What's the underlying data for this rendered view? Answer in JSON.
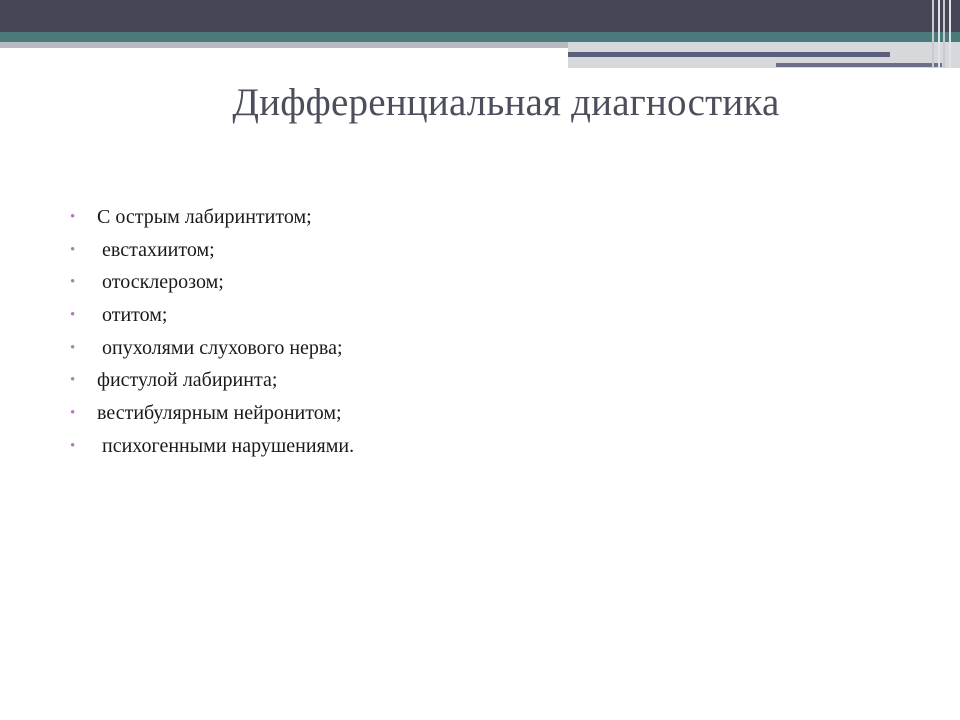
{
  "slide": {
    "title": "Дифференциальная диагностика",
    "bullet_glyph": "•",
    "items": [
      "С острым лабиринтитом;",
      " евстахиитом;",
      " отосклерозом;",
      " отитом;",
      " опухолями слухового нерва;",
      "фистулой лабиринта;",
      "вестибулярным нейронитом;",
      " психогенными нарушениями."
    ]
  },
  "colors": {
    "header_dark": "#454656",
    "header_teal": "#4a7a7c",
    "title_text": "#4c4e5c",
    "bullet": "#b07ab8",
    "body_text": "#1a1a1a"
  }
}
